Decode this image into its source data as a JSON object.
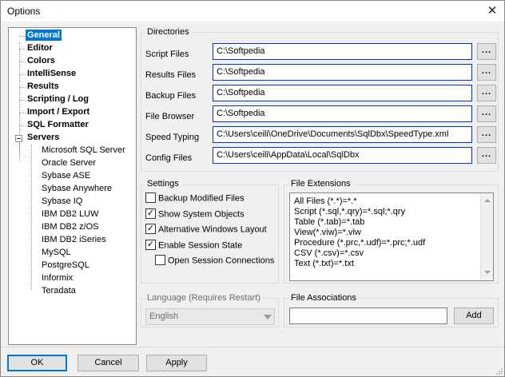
{
  "window": {
    "title": "Options",
    "close_glyph": "✕"
  },
  "tree": {
    "top_items": [
      {
        "label": "General",
        "selected": true
      },
      {
        "label": "Editor"
      },
      {
        "label": "Colors"
      },
      {
        "label": "IntelliSense"
      },
      {
        "label": "Results"
      },
      {
        "label": "Scripting / Log"
      },
      {
        "label": "Import / Export"
      },
      {
        "label": "SQL Formatter"
      },
      {
        "label": "Servers",
        "expanded": true
      }
    ],
    "servers": [
      "Microsoft SQL Server",
      "Oracle Server",
      "Sybase ASE",
      "Sybase Anywhere",
      "Sybase IQ",
      "IBM DB2 LUW",
      "IBM DB2 z/OS",
      "IBM DB2 iSeries",
      "MySQL",
      "PostgreSQL",
      "Informix",
      "Teradata"
    ]
  },
  "directories": {
    "group_label": "Directories",
    "browse_label": "...",
    "fields": [
      {
        "label": "Script Files",
        "value": "C:\\Softpedia"
      },
      {
        "label": "Results Files",
        "value": "C:\\Softpedia"
      },
      {
        "label": "Backup Files",
        "value": "C:\\Softpedia"
      },
      {
        "label": "File Browser",
        "value": "C:\\Softpedia"
      },
      {
        "label": "Speed Typing",
        "value": "C:\\Users\\ceili\\OneDrive\\Documents\\SqlDbx\\SpeedType.xml"
      },
      {
        "label": "Config Files",
        "value": "C:\\Users\\ceili\\AppData\\Local\\SqlDbx"
      }
    ]
  },
  "settings": {
    "group_label": "Settings",
    "options": [
      {
        "label": "Backup Modified Files",
        "checked": false
      },
      {
        "label": "Show System Objects",
        "checked": true
      },
      {
        "label": "Alternative Windows Layout",
        "checked": true
      },
      {
        "label": "Enable Session State",
        "checked": true
      },
      {
        "label": "Open Session Connections",
        "checked": false
      }
    ]
  },
  "file_extensions": {
    "group_label": "File Extensions",
    "lines": [
      "All Files (*.*)=*.*",
      "Script (*.sql,*.qry)=*.sql;*.qry",
      "Table (*.tab)=*.tab",
      "View(*.viw)=*.viw",
      "Procedure (*.prc,*.udf)=*.prc;*.udf",
      "CSV (*.csv)=*.csv",
      "Text (*.txt)=*.txt"
    ]
  },
  "language": {
    "group_label": "Language (Requires Restart)",
    "selected": "English"
  },
  "file_associations": {
    "group_label": "File Associations",
    "input_value": "",
    "add_label": "Add"
  },
  "footer": {
    "ok_label": "OK",
    "cancel_label": "Cancel",
    "apply_label": "Apply"
  },
  "colors": {
    "selection": "#0078d7",
    "focus_border": "#0033cc"
  }
}
